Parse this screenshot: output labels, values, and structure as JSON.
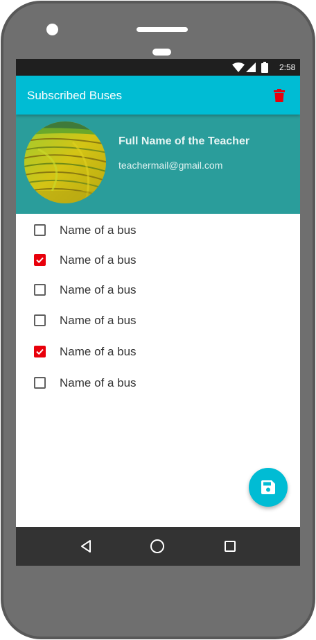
{
  "status_bar": {
    "time": "2:58"
  },
  "app_bar": {
    "title": "Subscribed Buses",
    "delete_icon": "trash-icon"
  },
  "profile": {
    "name": "Full Name of the Teacher",
    "email": "teachermail@gmail.com"
  },
  "buses": [
    {
      "label": "Name of a bus",
      "checked": false
    },
    {
      "label": "Name of a bus",
      "checked": true
    },
    {
      "label": "Name of a bus",
      "checked": false
    },
    {
      "label": "Name of a bus",
      "checked": false
    },
    {
      "label": "Name of a bus",
      "checked": true
    },
    {
      "label": "Name of a bus",
      "checked": false
    }
  ],
  "fab": {
    "icon": "save-icon"
  },
  "colors": {
    "app_bar": "#00bcd4",
    "profile_header": "#2a9d9b",
    "checked": "#e8000b",
    "delete": "#e8000b",
    "nav_bar": "#333333"
  }
}
